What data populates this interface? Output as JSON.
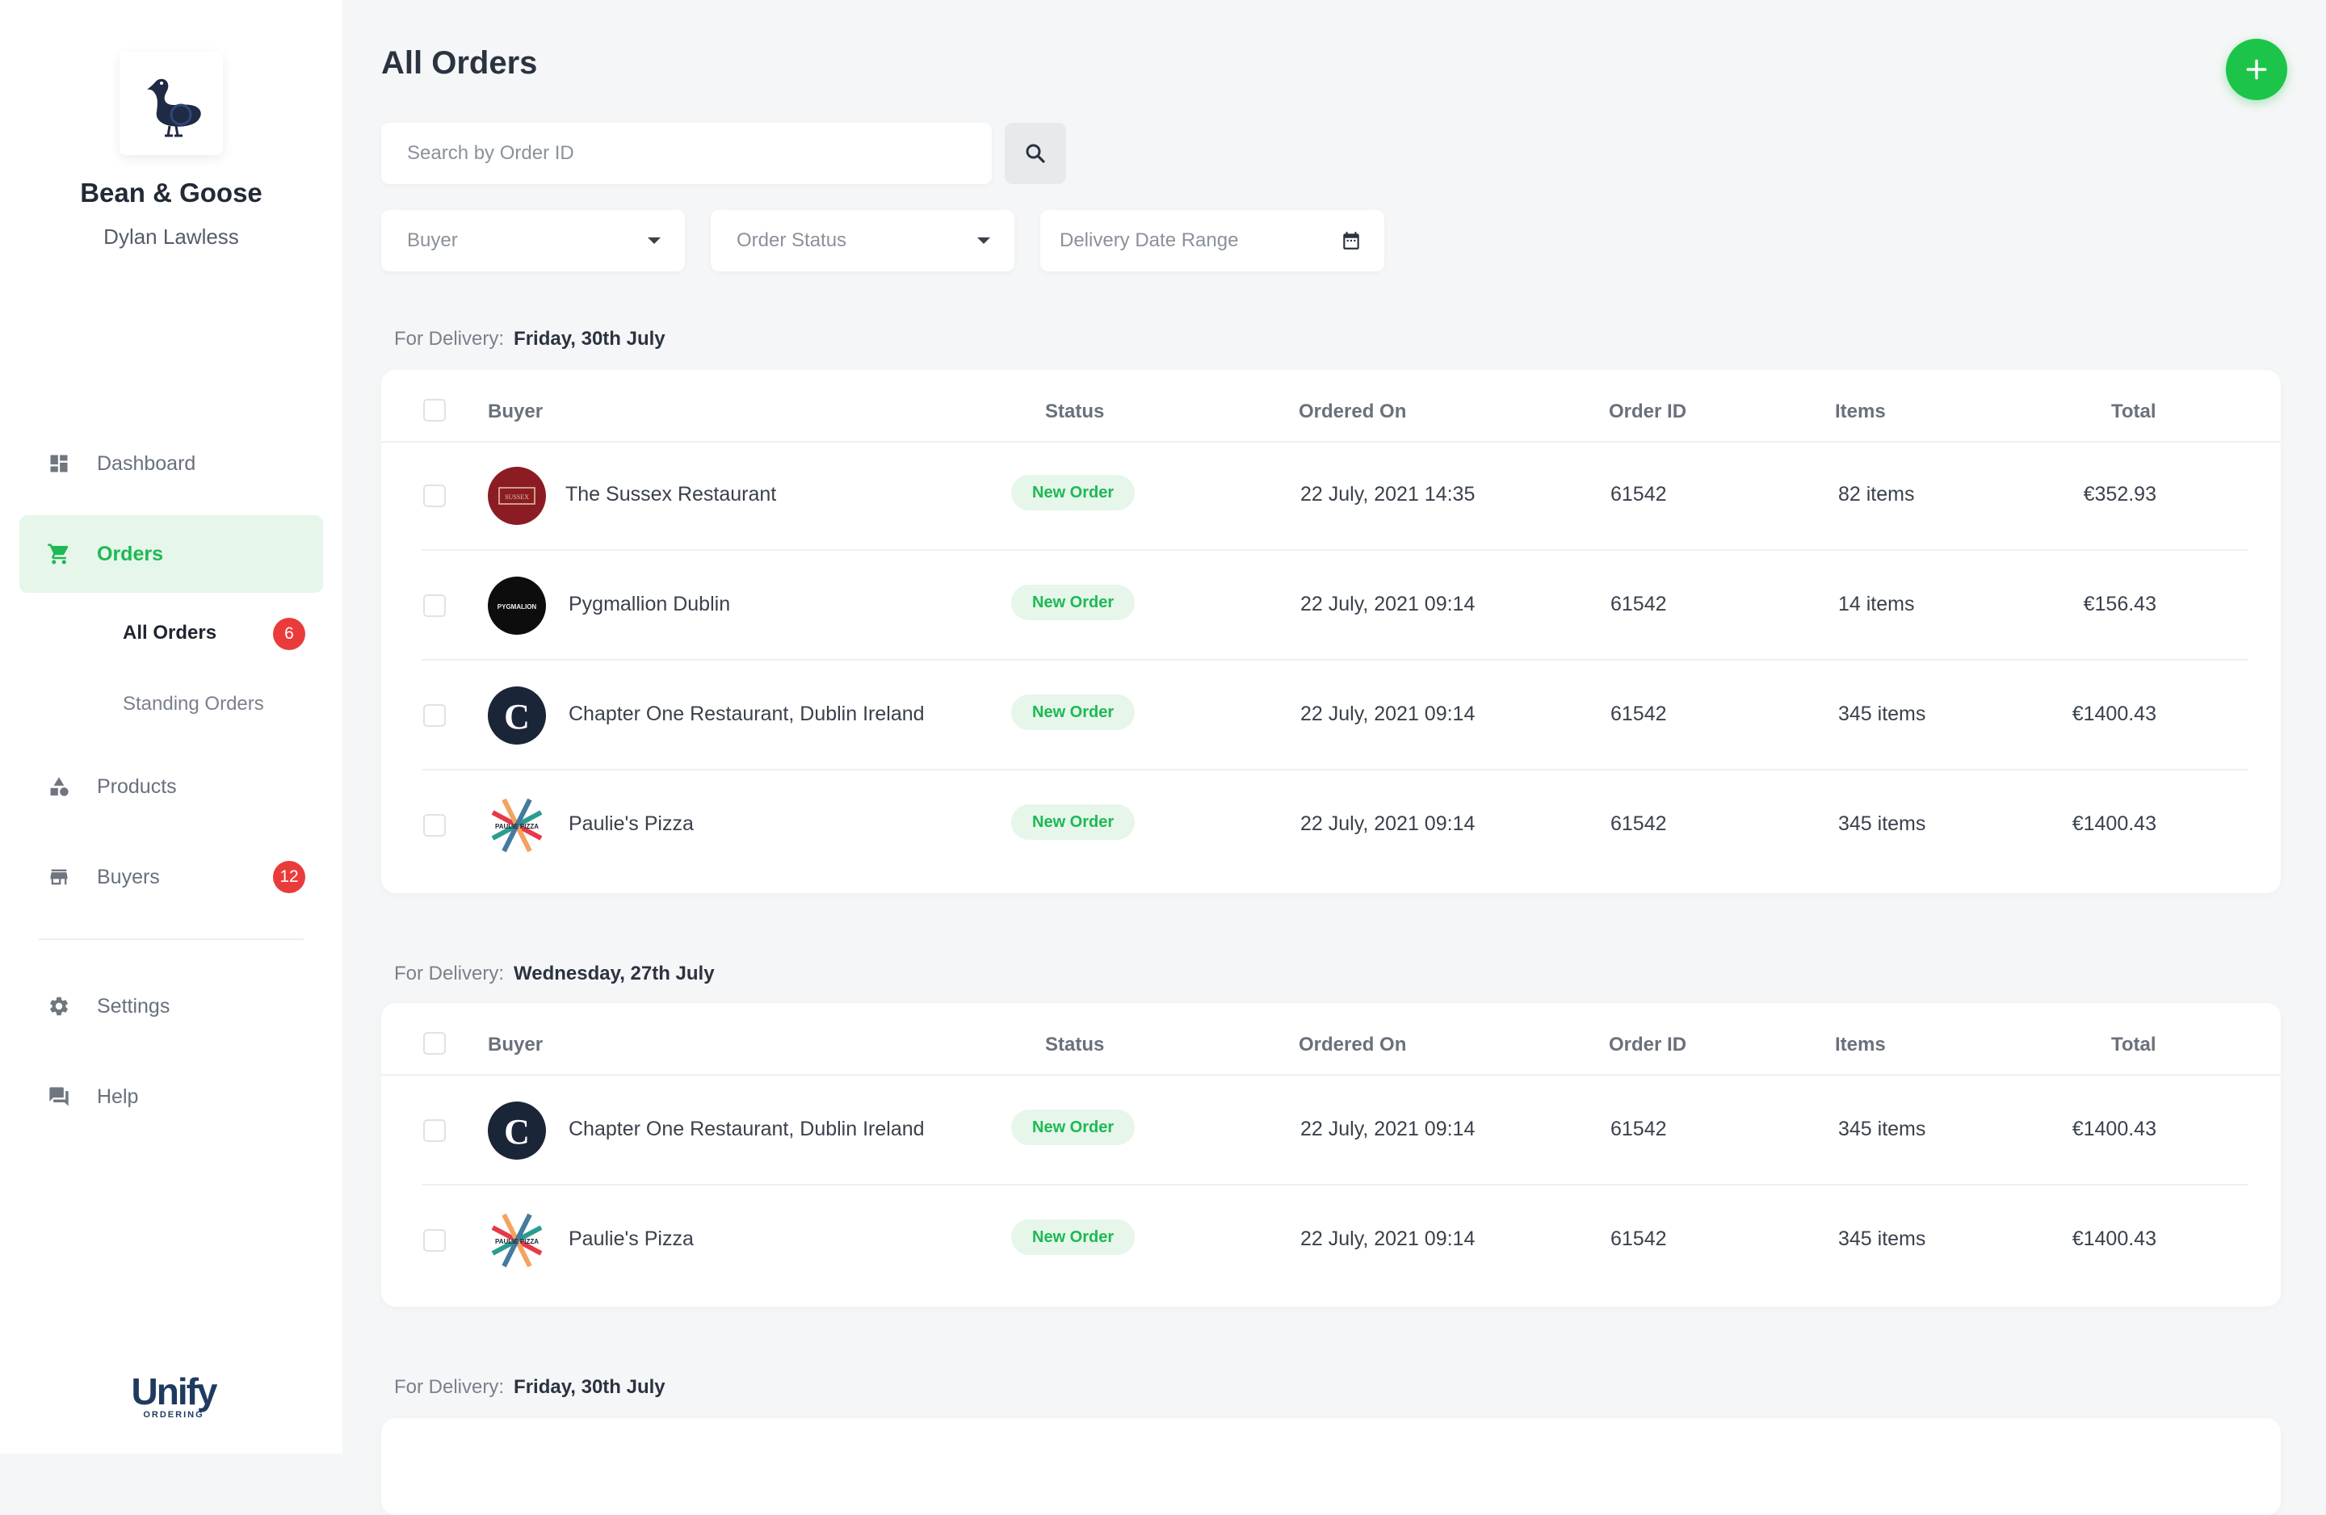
{
  "brand": {
    "name": "Bean & Goose",
    "user": "Dylan Lawless",
    "footer_logo": "Unify",
    "footer_sub": "ORDERING"
  },
  "nav": {
    "dashboard": "Dashboard",
    "orders": "Orders",
    "all_orders": "All Orders",
    "all_orders_badge": "6",
    "standing_orders": "Standing Orders",
    "products": "Products",
    "buyers": "Buyers",
    "buyers_badge": "12",
    "settings": "Settings",
    "help": "Help"
  },
  "header": {
    "title": "All Orders"
  },
  "search": {
    "placeholder": "Search by Order ID"
  },
  "filters": {
    "buyer": "Buyer",
    "status": "Order Status",
    "date": "Delivery Date Range"
  },
  "table_headers": {
    "buyer": "Buyer",
    "status": "Status",
    "ordered_on": "Ordered On",
    "order_id": "Order ID",
    "items": "Items",
    "total": "Total"
  },
  "sections": [
    {
      "label": "For Delivery:",
      "date": "Friday, 30th July",
      "rows": [
        {
          "buyer": "The Sussex Restaurant",
          "status": "New Order",
          "ordered_on": "22 July, 2021 14:35",
          "order_id": "61542",
          "items": "82 items",
          "total": "€352.93",
          "logo_text": "SUSSEX"
        },
        {
          "buyer": "Pygmallion Dublin",
          "status": "New Order",
          "ordered_on": "22 July, 2021 09:14",
          "order_id": "61542",
          "items": "14 items",
          "total": "€156.43",
          "logo_text": "PYGMALION"
        },
        {
          "buyer": "Chapter One Restaurant, Dublin Ireland",
          "status": "New Order",
          "ordered_on": "22 July, 2021 09:14",
          "order_id": "61542",
          "items": "345 items",
          "total": "€1400.43",
          "logo_text": "C"
        },
        {
          "buyer": "Paulie's Pizza",
          "status": "New Order",
          "ordered_on": "22 July, 2021 09:14",
          "order_id": "61542",
          "items": "345 items",
          "total": "€1400.43",
          "logo_text": "PAULIE PIZZA"
        }
      ]
    },
    {
      "label": "For Delivery:",
      "date": "Wednesday, 27th July",
      "rows": [
        {
          "buyer": "Chapter One Restaurant, Dublin Ireland",
          "status": "New Order",
          "ordered_on": "22 July, 2021 09:14",
          "order_id": "61542",
          "items": "345 items",
          "total": "€1400.43",
          "logo_text": "C"
        },
        {
          "buyer": "Paulie's Pizza",
          "status": "New Order",
          "ordered_on": "22 July, 2021 09:14",
          "order_id": "61542",
          "items": "345 items",
          "total": "€1400.43",
          "logo_text": "PAULIE PIZZA"
        }
      ]
    },
    {
      "label": "For Delivery:",
      "date": "Friday, 30th July",
      "rows": []
    }
  ],
  "colors": {
    "accent": "#1cc549",
    "badge": "#ea3b3b",
    "active_bg": "#e6f6ea"
  }
}
